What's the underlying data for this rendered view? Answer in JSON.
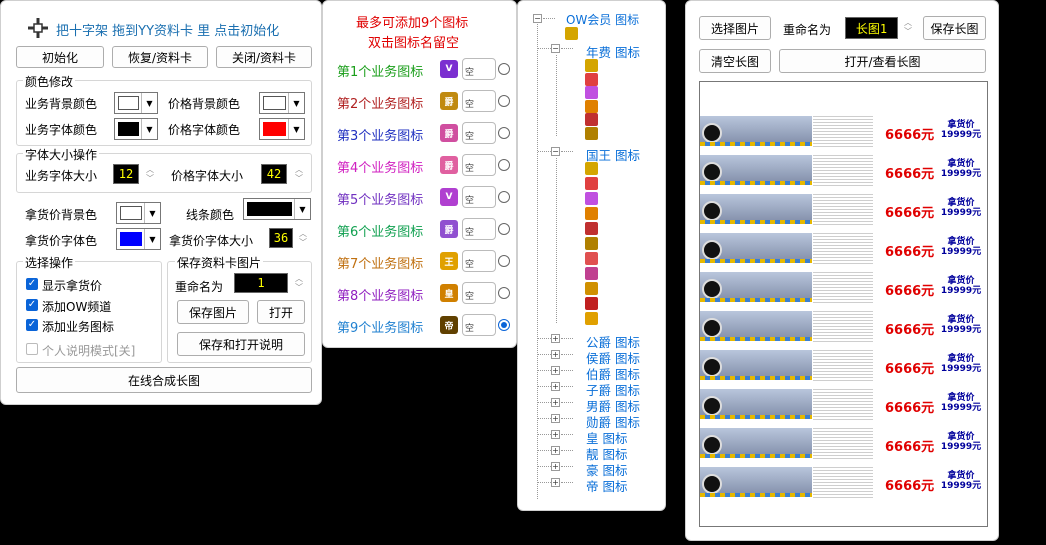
{
  "left_panel": {
    "tip": "把十字架 拖到YY资料卡 里 点击初始化",
    "buttons": {
      "init": "初始化",
      "restore": "恢复/资料卡",
      "close": "关闭/资料卡"
    },
    "color_group": {
      "title": "颜色修改",
      "biz_bg": "业务背景颜色",
      "price_bg": "价格背景颜色",
      "biz_font": "业务字体颜色",
      "price_font": "价格字体颜色",
      "colors": {
        "biz_bg": "#ffffff",
        "price_bg": "#ffffff",
        "biz_font": "#000000",
        "price_font": "#ff0000"
      }
    },
    "font_group": {
      "title": "字体大小操作",
      "biz_size_label": "业务字体大小",
      "biz_size": "12",
      "price_size_label": "价格字体大小",
      "price_size": "42"
    },
    "misc": {
      "pickup_bg": "拿货价背景色",
      "line_color": "线条颜色",
      "pickup_font": "拿货价字体色",
      "pickup_size_label": "拿货价字体大小",
      "pickup_size": "36",
      "colors": {
        "pickup_bg": "#ffffff",
        "line": "#000000",
        "pickup_font": "#0000ff"
      }
    },
    "select_group": {
      "title": "选择操作",
      "show_pickup": "显示拿货价",
      "add_ow": "添加OW频道",
      "add_biz": "添加业务图标",
      "personal_mode": "个人说明模式[关]"
    },
    "save_group": {
      "title": "保存资料卡图片",
      "rename_label": "重命名为",
      "rename_value": "1",
      "save_image": "保存图片",
      "open": "打开",
      "save_open_help": "保存和打开说明"
    },
    "compose": "在线合成长图"
  },
  "middle_panel": {
    "line1": "最多可添加9个图标",
    "line2": "双击图标名留空",
    "empty_text": "空",
    "slots": [
      {
        "label": "第1个业务图标",
        "color": "#1a9e1a",
        "icon_text": "V",
        "icon_color": "#7b2fd0",
        "selected": false
      },
      {
        "label": "第2个业务图标",
        "color": "#b02020",
        "icon_text": "爵",
        "icon_color": "#c08a10",
        "selected": false
      },
      {
        "label": "第3个业务图标",
        "color": "#2030c0",
        "icon_text": "爵",
        "icon_color": "#d04fa0",
        "selected": false
      },
      {
        "label": "第4个业务图标",
        "color": "#d020c0",
        "icon_text": "爵",
        "icon_color": "#e060a0",
        "selected": false
      },
      {
        "label": "第5个业务图标",
        "color": "#7030c0",
        "icon_text": "V",
        "icon_color": "#b040d0",
        "selected": false
      },
      {
        "label": "第6个业务图标",
        "color": "#10a050",
        "icon_text": "爵",
        "icon_color": "#9050d0",
        "selected": false
      },
      {
        "label": "第7个业务图标",
        "color": "#c07010",
        "icon_text": "王",
        "icon_color": "#e0a000",
        "selected": false
      },
      {
        "label": "第8个业务图标",
        "color": "#9020c0",
        "icon_text": "皇",
        "icon_color": "#d08000",
        "selected": false
      },
      {
        "label": "第9个业务图标",
        "color": "#2080d0",
        "icon_text": "帝",
        "icon_color": "#604000",
        "selected": true
      }
    ]
  },
  "tree_panel": {
    "root": "OW会员 图标",
    "nodes": [
      {
        "label": "年费 图标",
        "expanded": true
      },
      {
        "label": "国王 图标",
        "expanded": true
      },
      {
        "label": "公爵 图标",
        "expanded": false
      },
      {
        "label": "侯爵 图标",
        "expanded": false
      },
      {
        "label": "伯爵 图标",
        "expanded": false
      },
      {
        "label": "子爵 图标",
        "expanded": false
      },
      {
        "label": "男爵 图标",
        "expanded": false
      },
      {
        "label": "勋爵 图标",
        "expanded": false
      },
      {
        "label": "皇 图标",
        "expanded": false
      },
      {
        "label": "靓 图标",
        "expanded": false
      },
      {
        "label": "豪 图标",
        "expanded": false
      },
      {
        "label": "帝 图标",
        "expanded": false
      }
    ]
  },
  "right_panel": {
    "select_image": "选择图片",
    "rename_label": "重命名为",
    "rename_value": "长图1",
    "save_long": "保存长图",
    "clear_long": "清空长图",
    "open_view": "打开/查看长图",
    "cards": [
      {
        "price": "6666元",
        "pickup_line1": "拿货价",
        "pickup_line2": "19999元"
      },
      {
        "price": "6666元",
        "pickup_line1": "拿货价",
        "pickup_line2": "19999元"
      },
      {
        "price": "6666元",
        "pickup_line1": "拿货价",
        "pickup_line2": "19999元"
      },
      {
        "price": "6666元",
        "pickup_line1": "拿货价",
        "pickup_line2": "19999元"
      },
      {
        "price": "6666元",
        "pickup_line1": "拿货价",
        "pickup_line2": "19999元"
      },
      {
        "price": "6666元",
        "pickup_line1": "拿货价",
        "pickup_line2": "19999元"
      },
      {
        "price": "6666元",
        "pickup_line1": "拿货价",
        "pickup_line2": "19999元"
      },
      {
        "price": "6666元",
        "pickup_line1": "拿货价",
        "pickup_line2": "19999元"
      },
      {
        "price": "6666元",
        "pickup_line1": "拿货价",
        "pickup_line2": "19999元"
      },
      {
        "price": "6666元",
        "pickup_line1": "拿货价",
        "pickup_line2": "19999元"
      }
    ]
  }
}
